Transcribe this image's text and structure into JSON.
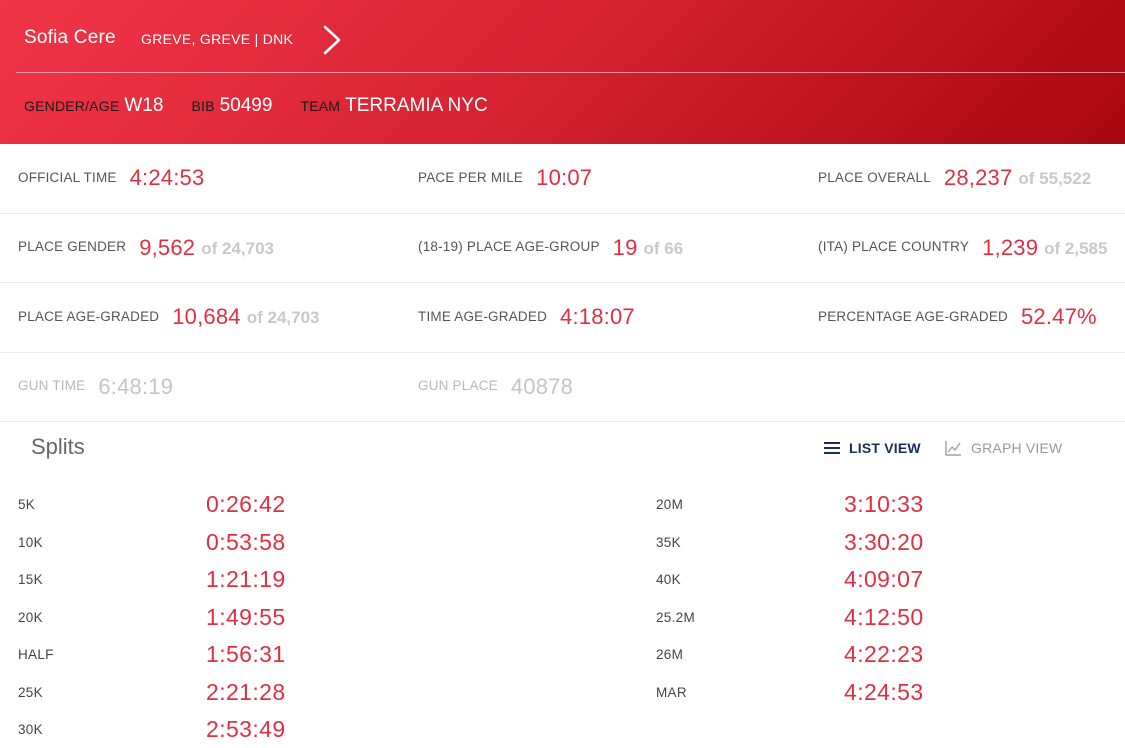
{
  "runner": {
    "name": "Sofia Cere",
    "location": "GREVE, GREVE | DNK",
    "gender_age_label": "GENDER/AGE",
    "gender_age": "W18",
    "bib_label": "BIB",
    "bib": "50499",
    "team_label": "TEAM",
    "team": "TERRAMIA NYC"
  },
  "stats": [
    [
      {
        "label": "OFFICIAL TIME",
        "value": "4:24:53",
        "of": ""
      },
      {
        "label": "PACE PER MILE",
        "value": "10:07",
        "of": ""
      },
      {
        "label": "PLACE OVERALL",
        "value": "28,237",
        "of": "of 55,522"
      }
    ],
    [
      {
        "label": "PLACE GENDER",
        "value": "9,562",
        "of": "of 24,703"
      },
      {
        "label": "(18-19) PLACE AGE-GROUP",
        "value": "19",
        "of": "of 66"
      },
      {
        "label": "(ITA) PLACE COUNTRY",
        "value": "1,239",
        "of": "of 2,585"
      }
    ],
    [
      {
        "label": "PLACE AGE-GRADED",
        "value": "10,684",
        "of": "of 24,703"
      },
      {
        "label": "TIME AGE-GRADED",
        "value": "4:18:07",
        "of": ""
      },
      {
        "label": "PERCENTAGE AGE-GRADED",
        "value": "52.47%",
        "of": ""
      }
    ],
    [
      {
        "label": "GUN TIME",
        "value": "6:48:19",
        "of": ""
      },
      {
        "label": "GUN PLACE",
        "value": "40878",
        "of": ""
      }
    ]
  ],
  "splits": {
    "title": "Splits",
    "list_view_label": "LIST VIEW",
    "graph_view_label": "GRAPH VIEW",
    "active_view": "LIST VIEW",
    "left": [
      {
        "label": "5K",
        "time": "0:26:42"
      },
      {
        "label": "10K",
        "time": "0:53:58"
      },
      {
        "label": "15K",
        "time": "1:21:19"
      },
      {
        "label": "20K",
        "time": "1:49:55"
      },
      {
        "label": "HALF",
        "time": "1:56:31"
      },
      {
        "label": "25K",
        "time": "2:21:28"
      },
      {
        "label": "30K",
        "time": "2:53:49"
      }
    ],
    "right": [
      {
        "label": "20M",
        "time": "3:10:33"
      },
      {
        "label": "35K",
        "time": "3:30:20"
      },
      {
        "label": "40K",
        "time": "4:09:07"
      },
      {
        "label": "25.2M",
        "time": "4:12:50"
      },
      {
        "label": "26M",
        "time": "4:22:23"
      },
      {
        "label": "MAR",
        "time": "4:24:53"
      }
    ]
  },
  "colors": {
    "accent_red": "#e03040",
    "header_gradient_start": "#f13548",
    "header_gradient_end": "#a8070f",
    "active_view_navy": "#1b2d5c"
  },
  "icons": {
    "next": "chevron-right-icon",
    "list_view": "list-icon",
    "graph_view": "line-chart-icon"
  }
}
